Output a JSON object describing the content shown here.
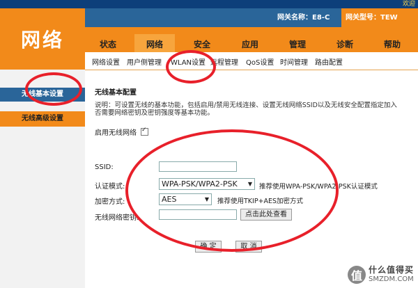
{
  "header": {
    "welcome": "欢迎",
    "logo": "网络",
    "gateway_label": "网关名称：E8-C",
    "model_label": "网关型号：TEW"
  },
  "main_tabs": [
    "状态",
    "网络",
    "安全",
    "应用",
    "管理",
    "诊断",
    "帮助"
  ],
  "active_tab": "网络",
  "sub_tabs": [
    "网络设置",
    "用户侧管理",
    "WLAN设置",
    "远程管理",
    "QoS设置",
    "时间管理",
    "路由配置"
  ],
  "sidebar": {
    "basic": "无线基本设置",
    "advanced": "无线高级设置"
  },
  "content": {
    "title": "无线基本配置",
    "desc_line1": "说明：可设置无线的基本功能，包括启用/禁用无线连接、设置无线网络SSID以及无线安全配置指定加入",
    "desc_line2": "否需要网络密钥及密钥强度等基本功能。",
    "enable_label": "启用无线网络",
    "ssid_label": "SSID:",
    "ssid_value": "",
    "auth_label": "认证模式:",
    "auth_value": "WPA-PSK/WPA2-PSK",
    "auth_hint": "推荐使用WPA-PSK/WPA2-PSK认证模式",
    "enc_label": "加密方式:",
    "enc_value": "AES",
    "enc_hint": "推荐使用TKIP+AES加密方式",
    "key_label": "无线网络密钥:",
    "key_value": "",
    "view_button": "点击此处查看",
    "ok_button": "确 定",
    "cancel_button": "取 消"
  },
  "watermark": {
    "badge": "值",
    "cn": "什么值得买",
    "en": "SMZDM.COM"
  },
  "colors": {
    "orange": "#f28a1a",
    "blue": "#2a6599",
    "dark_blue": "#0d3f7a",
    "annotation_red": "#e8202a"
  }
}
